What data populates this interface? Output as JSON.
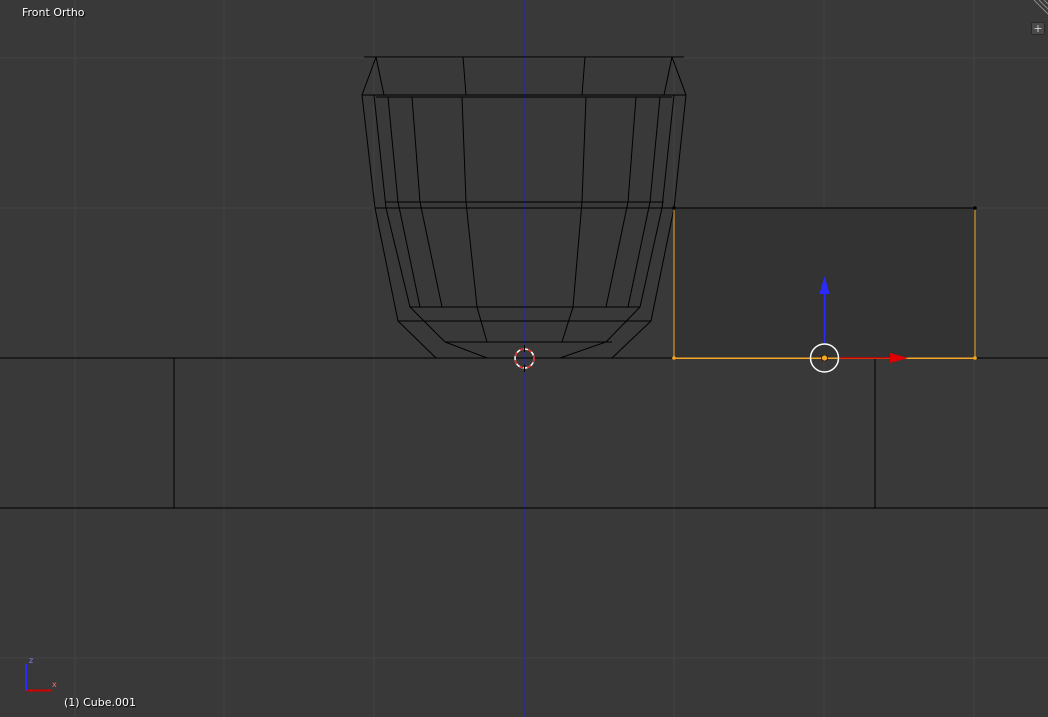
{
  "viewport": {
    "view_name": "Front Ortho",
    "active_object": "(1) Cube.001",
    "axis_z_letter": "z",
    "axis_x_letter": "x",
    "expand_symbol": "+",
    "colors": {
      "background": "#393939",
      "grid": "#434343",
      "z_axis_line": "#2d2d84",
      "wire": "#000000",
      "selected_edge": "#f5a623",
      "face_fill": "#333333",
      "gizmo_x": "#d00000",
      "gizmo_z": "#2a2aff"
    }
  }
}
